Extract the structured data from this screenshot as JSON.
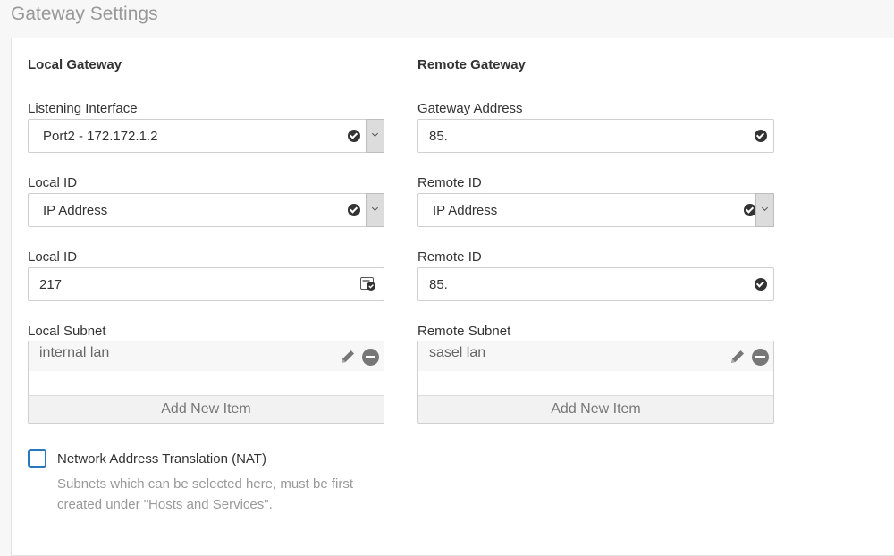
{
  "page": {
    "title": "Gateway Settings"
  },
  "local": {
    "heading": "Local Gateway",
    "listening_interface": {
      "label": "Listening Interface",
      "value": "Port2 - 172.172.1.2"
    },
    "id_type": {
      "label": "Local ID",
      "value": "IP Address"
    },
    "id_value": {
      "label": "Local ID",
      "value": "217"
    },
    "subnet": {
      "label": "Local Subnet",
      "items": [
        "internal lan"
      ],
      "add_label": "Add New Item"
    }
  },
  "remote": {
    "heading": "Remote Gateway",
    "gateway_address": {
      "label": "Gateway Address",
      "value": "85."
    },
    "id_type": {
      "label": "Remote ID",
      "value": "IP Address"
    },
    "id_value": {
      "label": "Remote ID",
      "value": "85."
    },
    "subnet": {
      "label": "Remote Subnet",
      "items": [
        "sasel lan"
      ],
      "add_label": "Add New Item"
    }
  },
  "nat": {
    "label": "Network Address Translation (NAT)",
    "checked": false,
    "help": "Subnets which can be selected here, must be first created under \"Hosts and Services\"."
  },
  "colors": {
    "accent": "#2a77c0",
    "muted_text": "#999999",
    "button_bg": "#dcdcdc"
  }
}
